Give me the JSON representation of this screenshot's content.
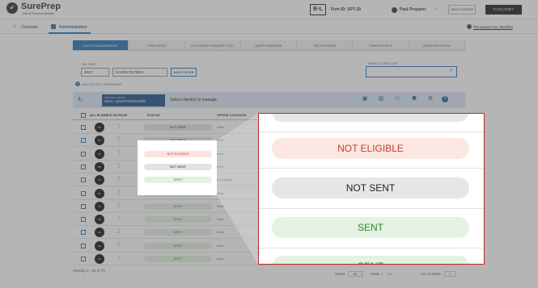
{
  "header": {
    "logo_name": "SurePrep",
    "logo_sub": "Part of Thomson Reuters",
    "firm_badge": "B·L",
    "firm_id": "Firm ID: SPT-29",
    "user_name": "Paul Preparer",
    "help_label": "HELP CENTER",
    "taxcaddy_label": "TAXCADDY"
  },
  "subnav": {
    "overview": "Overview",
    "administrative": "Administrative",
    "pre_season": "Pre-season tax checklist"
  },
  "tabs": [
    "CLIENT MANAGEMENT",
    "TEMPLATES",
    "DOCUMENT REQUEST LIST",
    "QUESTIONNAIRE",
    "TAX RETURNS",
    "FIRM DETAILS",
    "ADMIN SETTINGS"
  ],
  "filters": {
    "tax_year_label": "TAX YEAR",
    "tax_year_value": "2023",
    "saved_filters_value": "SAVED FILTERS",
    "save_filter_label": "SAVE FILTER",
    "search_label": "SEARCH CLIENT LIST",
    "add_filter": "ADD FILTER CATEGORIES"
  },
  "manage": {
    "label": "MANAGE CLIENTS",
    "value": "2023 - QUESTIONNAIRE",
    "message": "Select client(s) to manage."
  },
  "table": {
    "col_all": "ALL ELIGIBLE ON PAGE",
    "col_status": "STATUS",
    "col_office": "OFFICE LOCATION",
    "rows": [
      {
        "initials": "NT",
        "status": "NOT SENT",
        "type": "notsent",
        "office": "Irvine"
      },
      {
        "initials": "NT",
        "status": "NOT SENT",
        "type": "notsent",
        "office": "Irvine"
      },
      {
        "initials": "CC",
        "status": "NOT ELIGIBLE",
        "type": "inel",
        "office": "Irvine"
      },
      {
        "initials": "PP",
        "status": "NOT SENT",
        "type": "notsent",
        "office": "Irvine"
      },
      {
        "initials": "TT",
        "status": "SENT",
        "type": "sent",
        "office": "Los Angeles"
      },
      {
        "initials": "PL",
        "status": "SENT",
        "type": "sent",
        "office": "Irvine"
      },
      {
        "initials": "TL",
        "status": "SENT",
        "type": "sent",
        "office": "Irvine"
      },
      {
        "initials": "SS",
        "status": "SENT",
        "type": "sent",
        "office": "Irvine"
      },
      {
        "initials": "CC",
        "status": "SENT",
        "type": "sent",
        "office": "Irvine"
      },
      {
        "initials": "SS",
        "status": "SENT",
        "type": "sent",
        "office": "Irvine"
      },
      {
        "initials": "CC",
        "status": "SENT",
        "type": "sent",
        "office": "Irvine"
      }
    ]
  },
  "footer": {
    "viewing": "Viewing 1 - 50 of 76",
    "show": "SHOW",
    "show_value": "50",
    "page": "PAGE: 1",
    "page_numbers": "1  2",
    "goto": "GO TO PAGE:",
    "goto_value": "1"
  },
  "zoom": {
    "items": [
      "NOT ELIGIBLE",
      "NOT SENT",
      "SENT",
      "SENT"
    ]
  }
}
